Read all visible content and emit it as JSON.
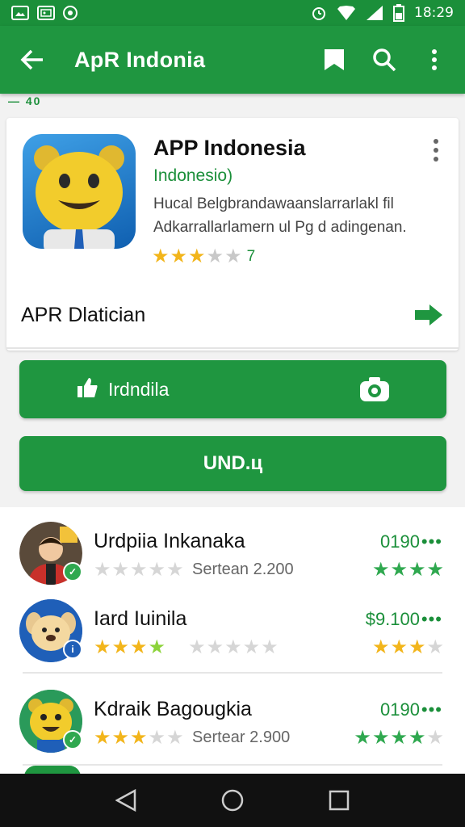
{
  "status_bar": {
    "left_icons": [
      "photo-icon",
      "image-icon",
      "circle-app-icon"
    ],
    "right_icons": [
      "alarm-icon",
      "wifi-icon",
      "signal-icon",
      "battery-icon"
    ],
    "time": "18:29"
  },
  "app_bar": {
    "title": "ApR Indonia",
    "back_icon": "arrow-back-icon",
    "action_icons": [
      "bookmark-icon",
      "search-icon",
      "more-vert-icon"
    ]
  },
  "stub_text": "— 40",
  "app_card": {
    "title": "APP Indonesia",
    "subtitle": "Indonesio)",
    "description_line1": "Hucal Belgbrandawaanslarrarlakl fil",
    "description_line2": "Adkarrallarlamern ul Pg d adingenan.",
    "rating_stars": 3,
    "rating_count": "7",
    "developer_label": "APR Dlatician",
    "developer_arrow_icon": "arrow-right-icon"
  },
  "buttons": {
    "primary_label": "Irdndila",
    "primary_left_icon": "thumbs-up-icon",
    "primary_right_icon": "camera-icon",
    "secondary_label": "UND.ц"
  },
  "list": {
    "items": [
      {
        "name": "Urdpiia Inkanaka",
        "meta": "Sertean 2.200",
        "price": "0190",
        "more": "•••",
        "left_stars": 0,
        "left_stars_style": "grey",
        "right_stars": 4,
        "right_stars_style": "green",
        "avatar": "person-avatar"
      },
      {
        "name": "Iard Iuinila",
        "meta": "",
        "price": "$9.100",
        "more": "•••",
        "left_stars": 4,
        "left_stars_style": "yellow",
        "right_stars": 3,
        "right_stars_style": "yellow",
        "avatar": "dog-avatar"
      },
      {
        "name": "Kdraik Bagougkia",
        "meta": "Sertear 2.900",
        "price": "0190",
        "more": "•••",
        "left_stars": 3,
        "left_stars_style": "yellow",
        "right_stars": 4,
        "right_stars_style": "green",
        "avatar": "bear-avatar"
      }
    ]
  },
  "nav_bar": {
    "icons": [
      "back-triangle-icon",
      "home-circle-icon",
      "recents-square-icon"
    ]
  },
  "colors": {
    "primary_green": "#1f9640",
    "text_green": "#1b8f3a",
    "star_yellow": "#f2b51b"
  }
}
